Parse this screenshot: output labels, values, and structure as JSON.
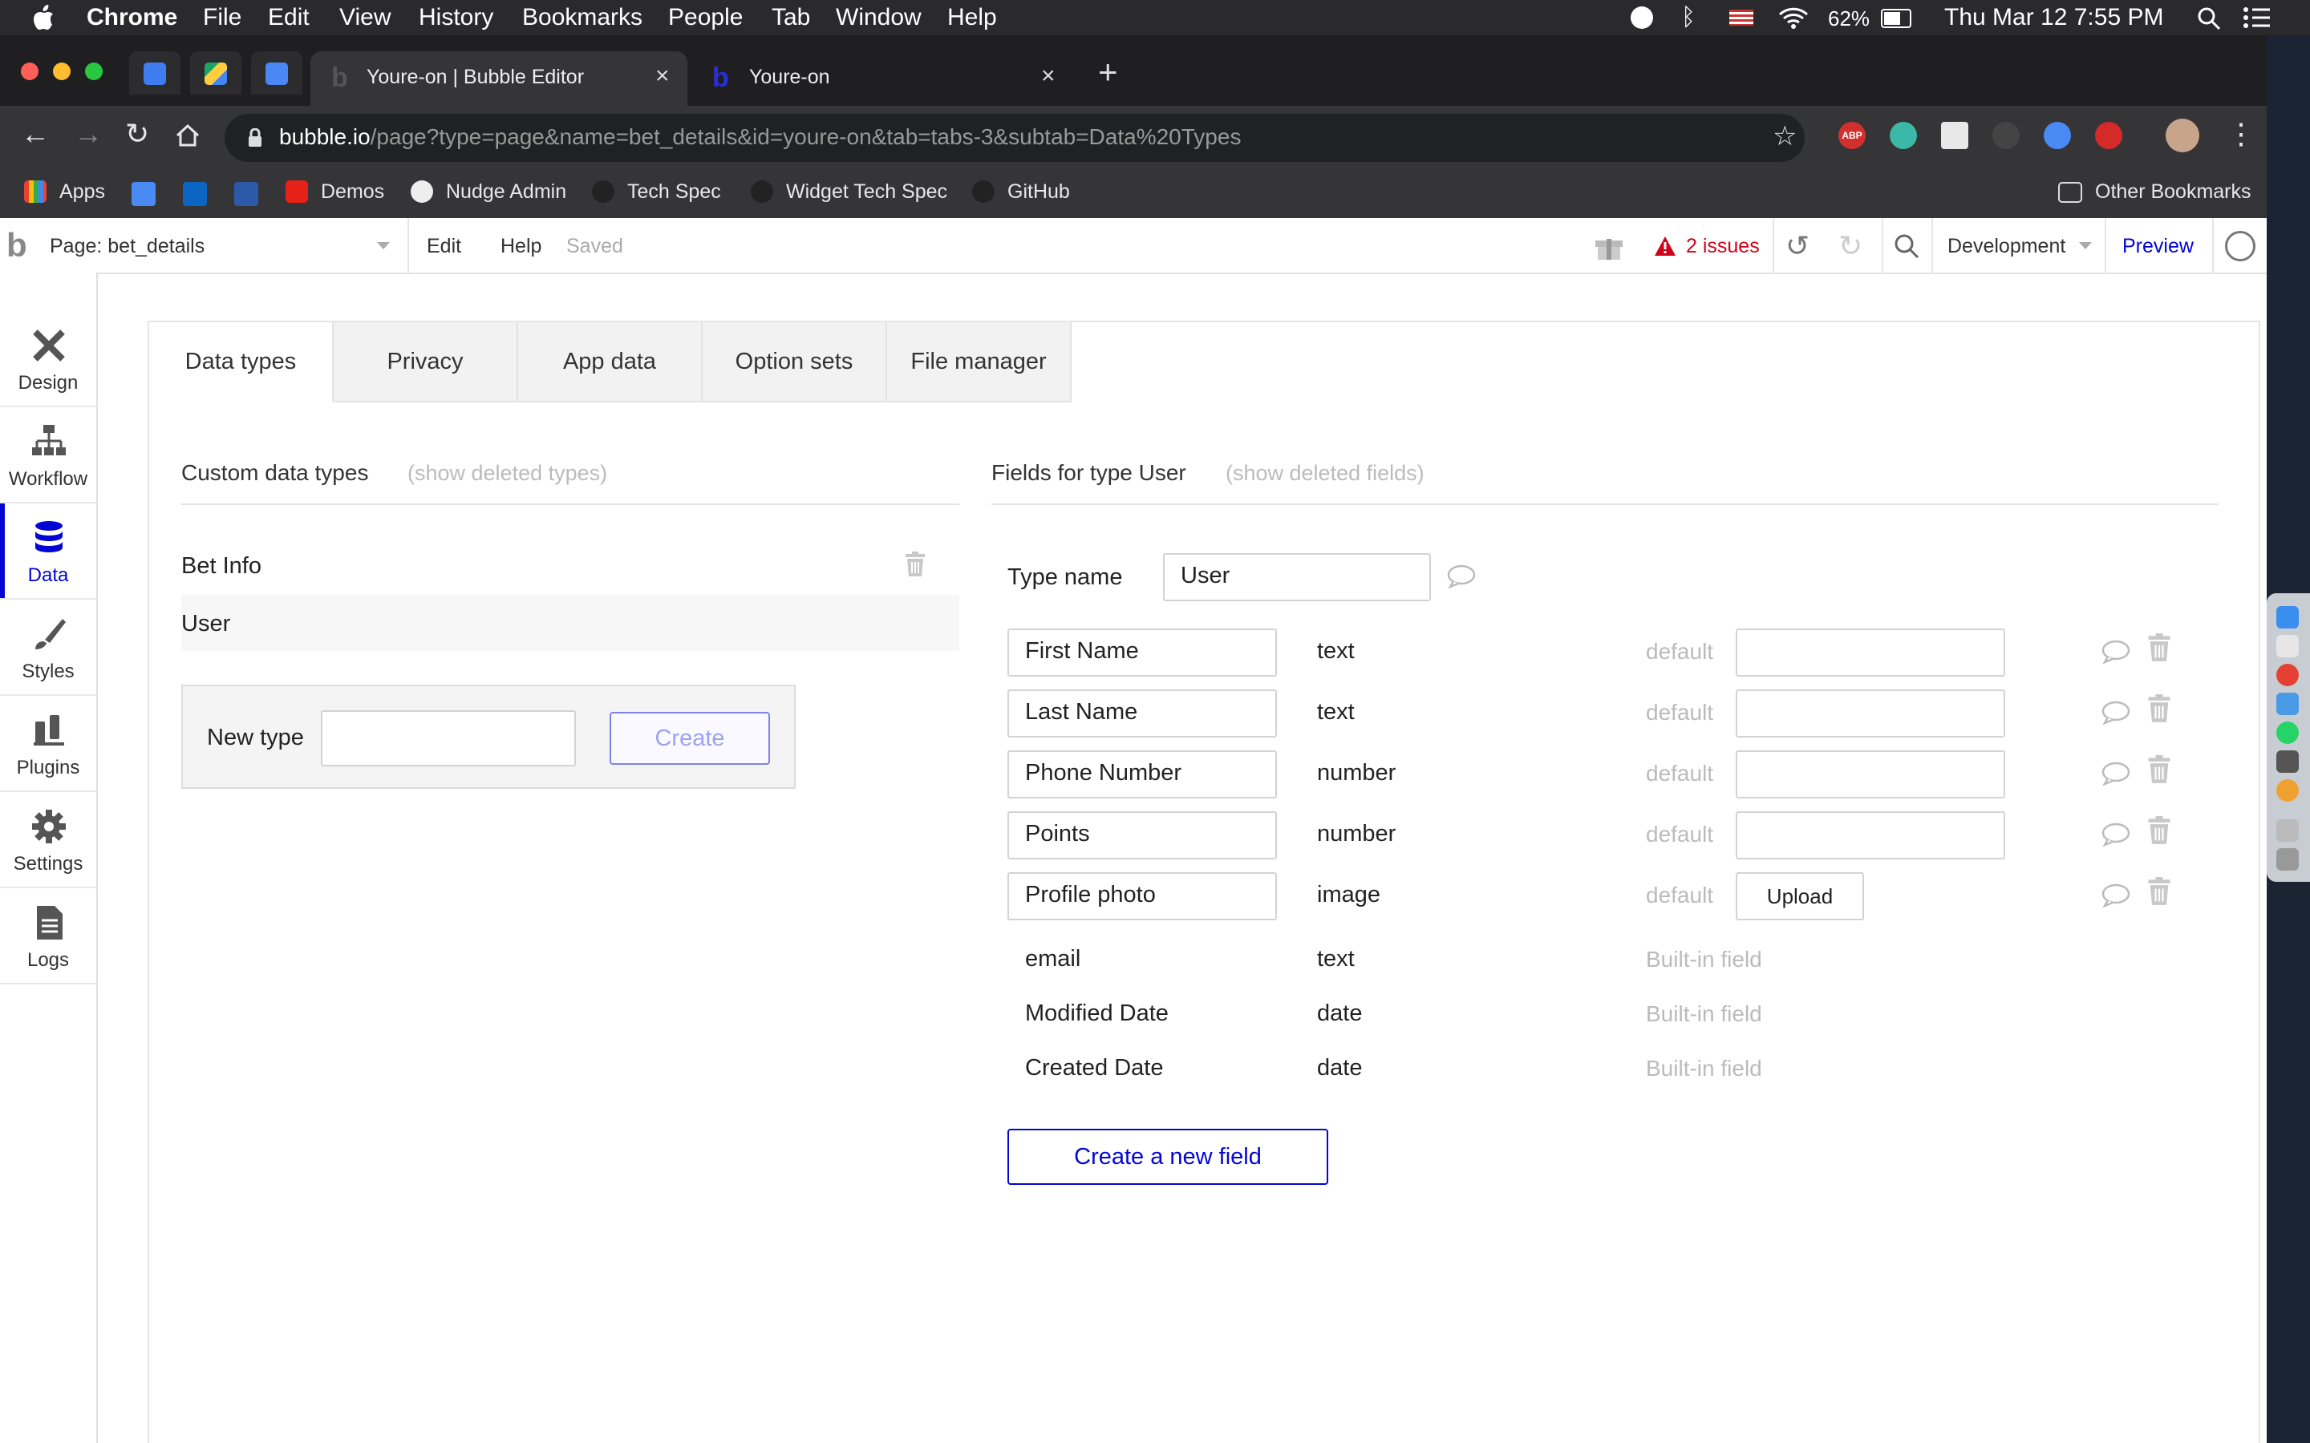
{
  "menubar": {
    "app": "Chrome",
    "items": [
      "File",
      "Edit",
      "View",
      "History",
      "Bookmarks",
      "People",
      "Tab",
      "Window",
      "Help"
    ],
    "battery": "62%",
    "clock": "Thu Mar 12  7:55 PM"
  },
  "browser": {
    "tabs": [
      {
        "title": "Youre-on | Bubble Editor",
        "active": true
      },
      {
        "title": "Youre-on",
        "active": false
      }
    ],
    "url_domain": "bubble.io",
    "url_path": "/page?type=page&name=bet_details&id=youre-on&tab=tabs-3&subtab=Data%20Types",
    "bookmarks": [
      "Apps",
      "Demos",
      "Nudge Admin",
      "Tech Spec",
      "Widget Tech Spec",
      "GitHub"
    ],
    "other_bookmarks": "Other Bookmarks",
    "ext_labels": {
      "abp": "ABP"
    }
  },
  "editor": {
    "page_selector": "Page: bet_details",
    "edit": "Edit",
    "help": "Help",
    "saved": "Saved",
    "issues": "2 issues",
    "environment": "Development",
    "preview": "Preview"
  },
  "sidebar": {
    "items": [
      {
        "label": "Design",
        "icon": "design-icon"
      },
      {
        "label": "Workflow",
        "icon": "workflow-icon"
      },
      {
        "label": "Data",
        "icon": "data-icon",
        "active": true
      },
      {
        "label": "Styles",
        "icon": "brush-icon"
      },
      {
        "label": "Plugins",
        "icon": "plug-icon"
      },
      {
        "label": "Settings",
        "icon": "gear-icon"
      },
      {
        "label": "Logs",
        "icon": "document-icon"
      }
    ]
  },
  "data_tabs": [
    "Data types",
    "Privacy",
    "App data",
    "Option sets",
    "File manager"
  ],
  "custom_types": {
    "heading": "Custom data types",
    "show_deleted": "(show deleted types)",
    "types": [
      "Bet Info",
      "User"
    ],
    "new_type_label": "New type",
    "new_type_value": "",
    "create_button": "Create"
  },
  "fields": {
    "heading": "Fields for type User",
    "show_deleted": "(show deleted fields)",
    "type_name_label": "Type name",
    "type_name_value": "User",
    "default_label": "default",
    "editable": [
      {
        "name": "First Name",
        "type": "text",
        "default": ""
      },
      {
        "name": "Last Name",
        "type": "text",
        "default": ""
      },
      {
        "name": "Phone Number",
        "type": "number",
        "default": ""
      },
      {
        "name": "Points",
        "type": "number",
        "default": ""
      },
      {
        "name": "Profile photo",
        "type": "image",
        "upload": "Upload"
      }
    ],
    "builtin_note": "Built-in field",
    "builtin": [
      {
        "name": "email",
        "type": "text"
      },
      {
        "name": "Modified Date",
        "type": "date"
      },
      {
        "name": "Created Date",
        "type": "date"
      }
    ],
    "create_button": "Create a new field"
  },
  "colors": {
    "accent": "#0205d3",
    "issues": "#d0021b"
  }
}
